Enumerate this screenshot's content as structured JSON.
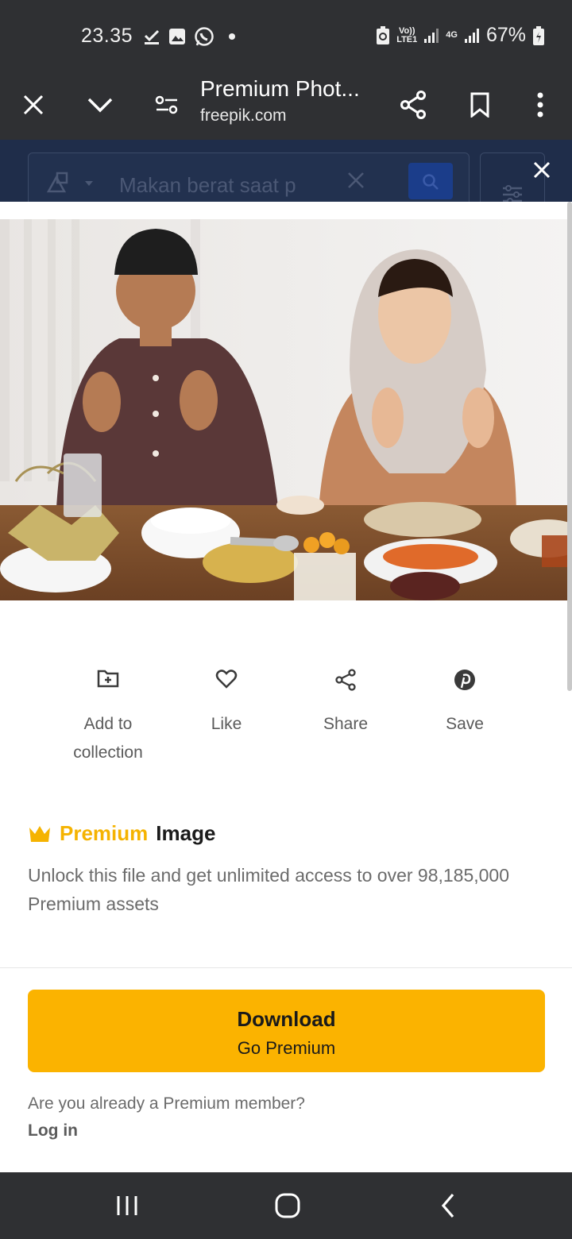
{
  "status_bar": {
    "time": "23.35",
    "net1": "Vo))\nLTE1",
    "net2": "4G",
    "battery": "67%"
  },
  "toolbar": {
    "title": "Premium Phot...",
    "url": "freepik.com"
  },
  "background_page": {
    "search_text": "Makan berat saat p"
  },
  "actions": [
    {
      "label": "Add to collection",
      "icon": "folder-plus-icon"
    },
    {
      "label": "Like",
      "icon": "heart-icon"
    },
    {
      "label": "Share",
      "icon": "share-icon"
    },
    {
      "label": "Save",
      "icon": "pinterest-icon"
    }
  ],
  "premium": {
    "word": "Premium",
    "type": "Image",
    "description": "Unlock this file and get unlimited access to over 98,185,000 Premium assets"
  },
  "download_button": {
    "label": "Download",
    "sublabel": "Go Premium"
  },
  "member": {
    "question": "Are you already a Premium member?",
    "login": "Log in"
  },
  "colors": {
    "accent": "#fbb300",
    "chrome": "#2f3033"
  }
}
